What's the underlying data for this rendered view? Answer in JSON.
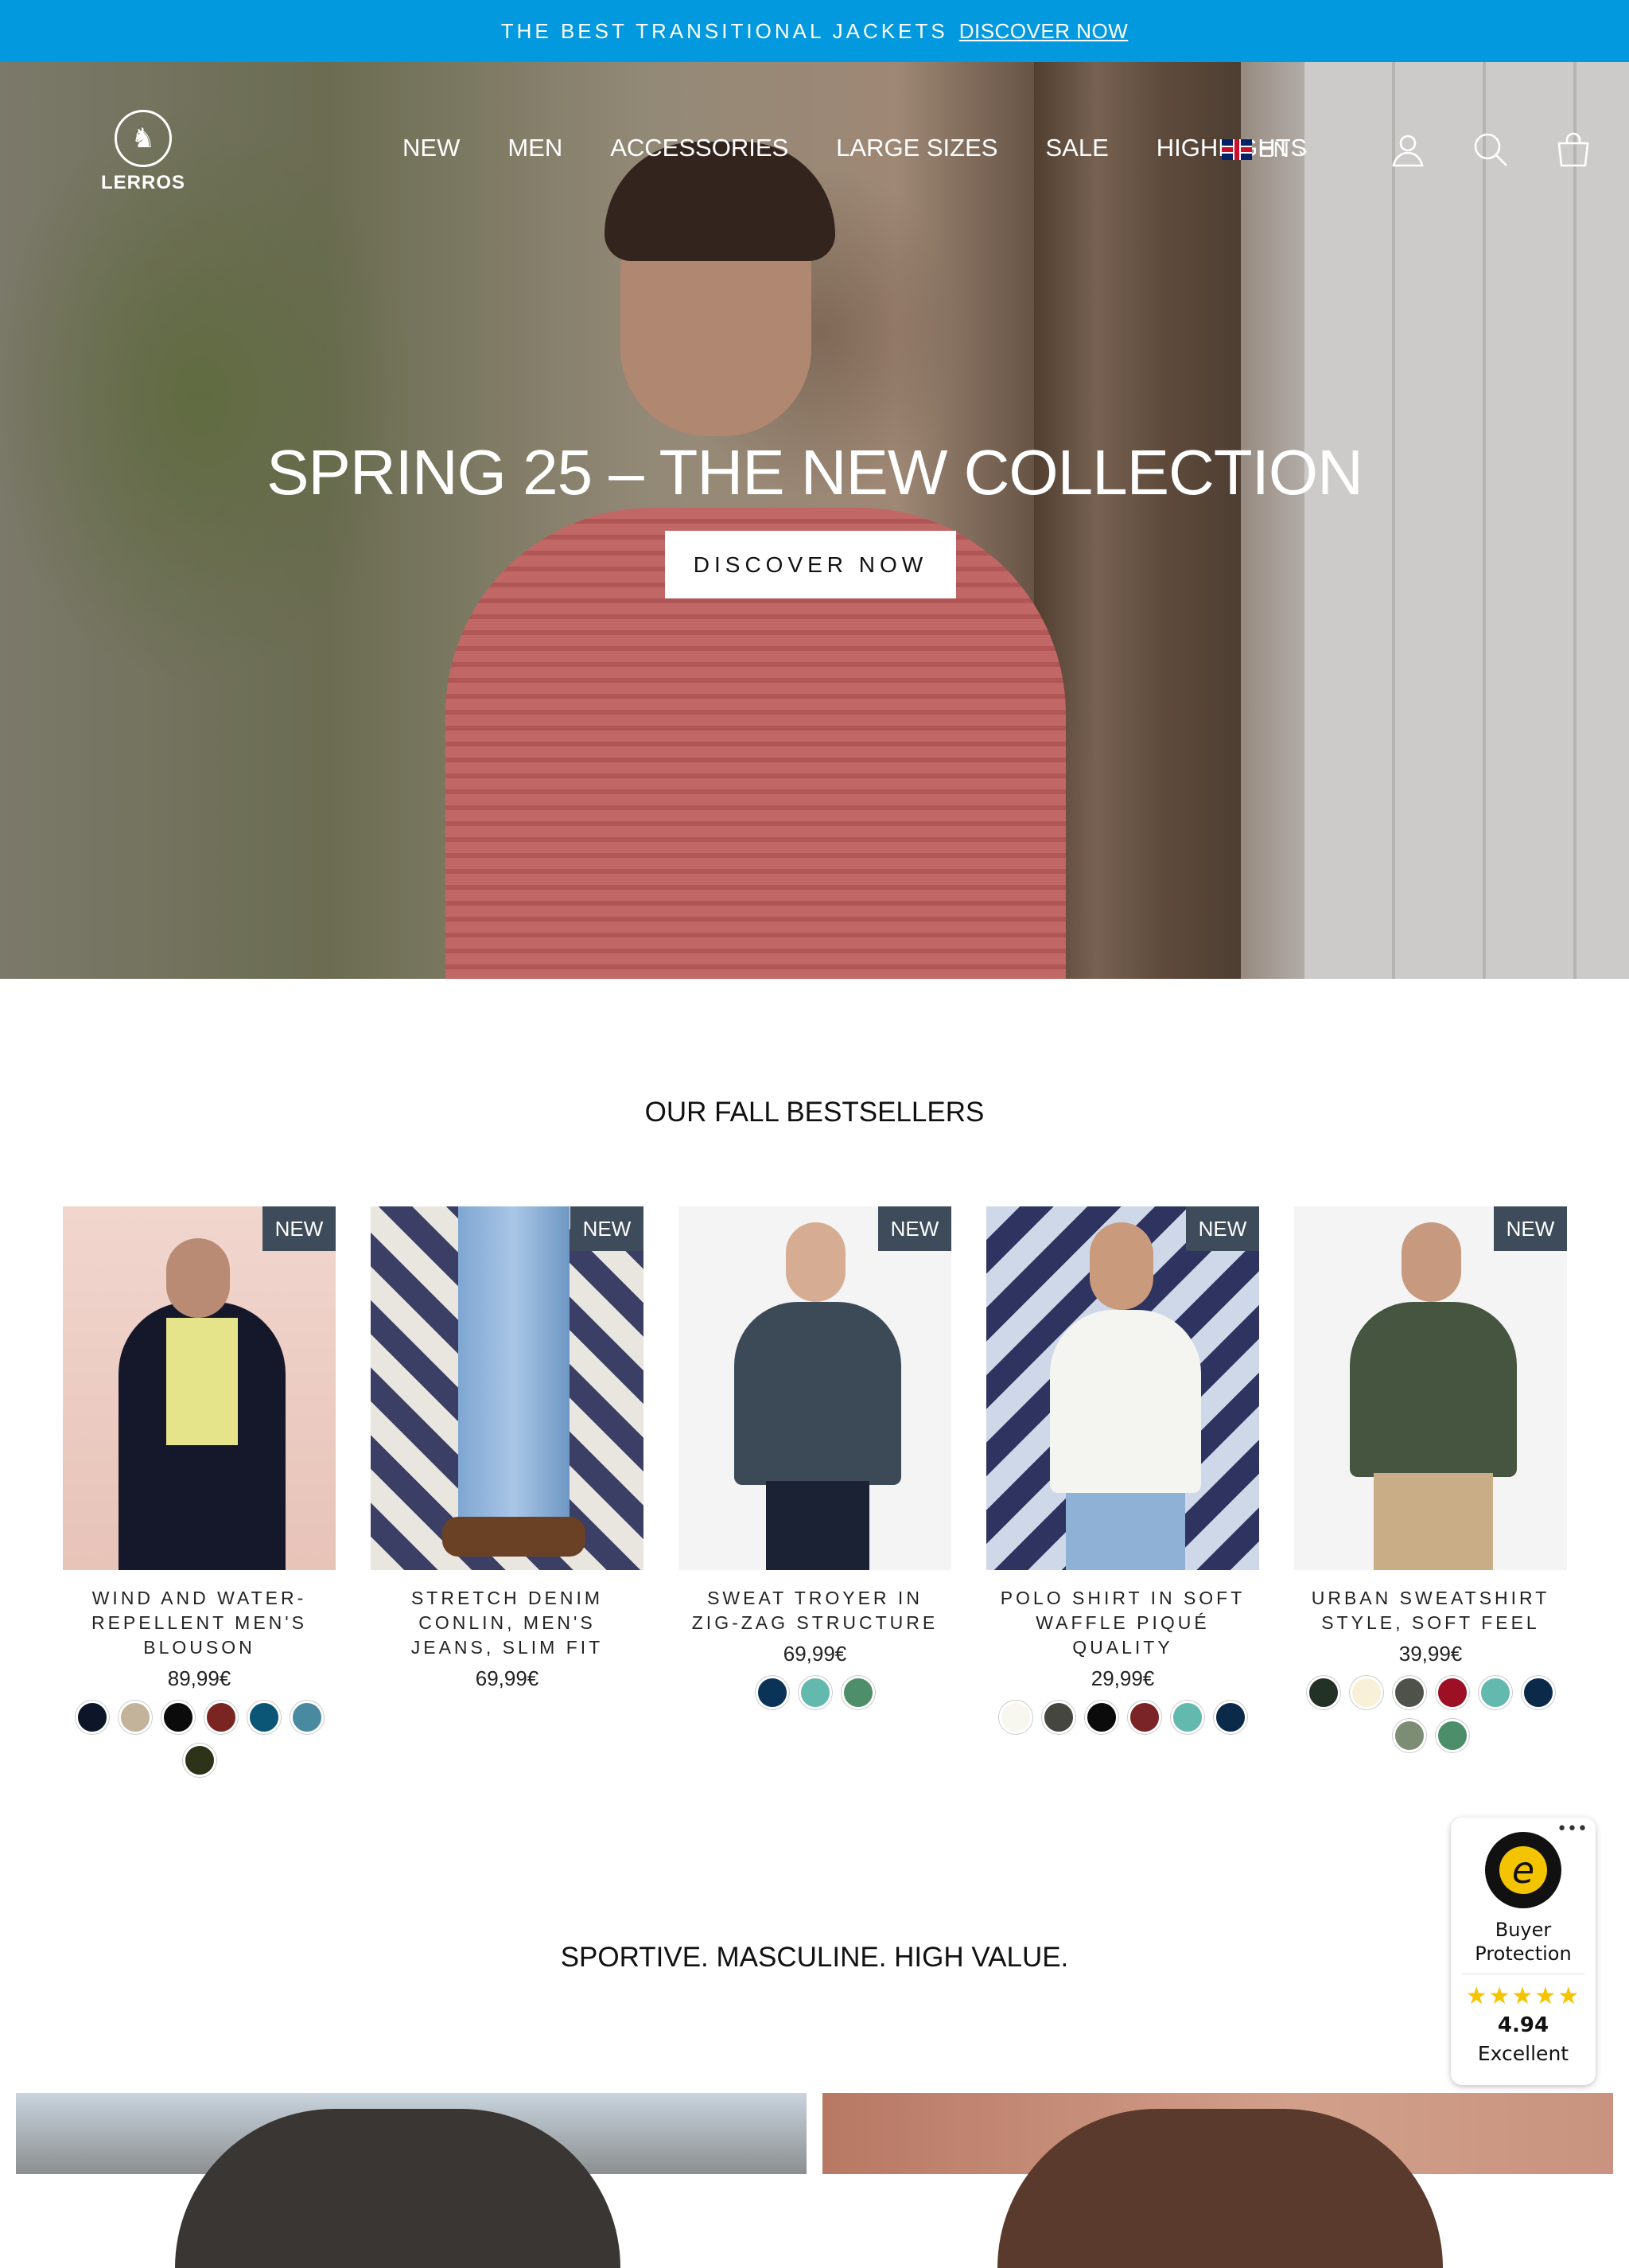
{
  "announcement": {
    "text": "THE BEST TRANSITIONAL JACKETS",
    "link": "DISCOVER NOW"
  },
  "header": {
    "logo_text": "LERROS",
    "nav": [
      "NEW",
      "MEN",
      "ACCESSORIES",
      "LARGE SIZES",
      "SALE",
      "HIGHLIGHTS"
    ],
    "language": "EN"
  },
  "hero": {
    "title": "SPRING 25 – THE NEW COLLECTION",
    "button": "DISCOVER NOW"
  },
  "bestsellers": {
    "title": "OUR FALL BESTSELLERS",
    "badge": "NEW",
    "products": [
      {
        "name": "WIND AND WATER-REPELLENT MEN'S BLOUSON",
        "price": "89,99€",
        "swatches": [
          "#0d1628",
          "#c2b39a",
          "#0b0b0b",
          "#7a2522",
          "#0b5576",
          "#4a8aa0",
          "#2c3318"
        ]
      },
      {
        "name": "STRETCH DENIM CONLIN, MEN'S JEANS, SLIM FIT",
        "price": "69,99€",
        "swatches": []
      },
      {
        "name": "SWEAT TROYER IN ZIG-ZAG STRUCTURE",
        "price": "69,99€",
        "swatches": [
          "#0b3358",
          "#63b9ad",
          "#4e8e69"
        ]
      },
      {
        "name": "POLO SHIRT IN SOFT WAFFLE PIQUÉ QUALITY",
        "price": "29,99€",
        "swatches": [
          "#f7f7ef",
          "#45463f",
          "#0b0b0b",
          "#7a2427",
          "#63b9ad",
          "#0b2a4a"
        ]
      },
      {
        "name": "URBAN SWEATSHIRT STYLE, SOFT FEEL",
        "price": "39,99€",
        "swatches": [
          "#233126",
          "#f8f1d7",
          "#4f524b",
          "#9d0f25",
          "#63b9ad",
          "#0b2a4a",
          "#7d8c74",
          "#4c8e69"
        ]
      }
    ]
  },
  "section2": {
    "title": "SPORTIVE. MASCULINE. HIGH VALUE."
  },
  "trust_badge": {
    "label": "Buyer Protection",
    "stars": "★★★★★",
    "score": "4.94",
    "rating": "Excellent",
    "seal_letter": "e"
  }
}
